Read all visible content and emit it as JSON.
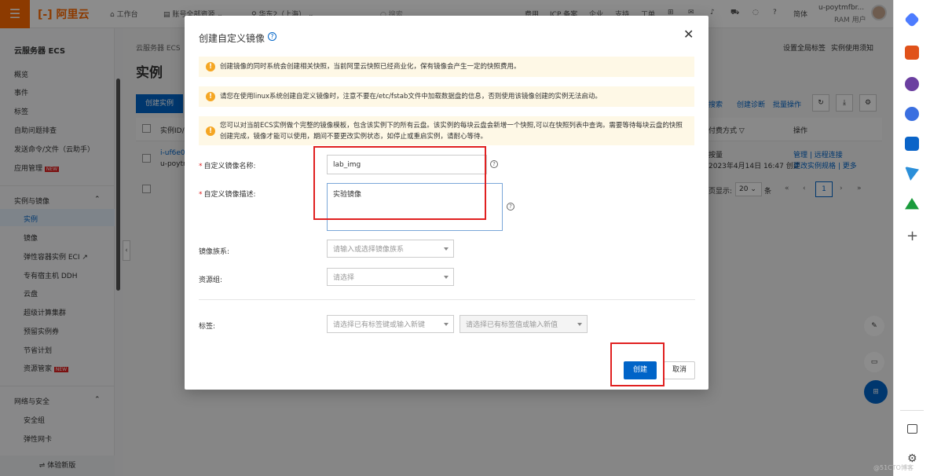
{
  "topbar": {
    "logo": "阿里云",
    "workbench": "工作台",
    "resources": "账号全部资源",
    "region": "华东2（上海）",
    "search_placeholder": "搜索...",
    "links": [
      "费用",
      "ICP 备案",
      "企业",
      "支持",
      "工单"
    ],
    "lang": "简体",
    "user_name": "u-poytmfbr...",
    "user_type": "RAM 用户"
  },
  "sidebar": {
    "title": "云服务器 ECS",
    "items": [
      "概览",
      "事件",
      "标签",
      "自助问题排查",
      "发送命令/文件（云助手）",
      "应用管理"
    ],
    "group1": "实例与镜像",
    "group1_items": [
      "实例",
      "镜像",
      "弹性容器实例 ECI",
      "专有宿主机 DDH",
      "云盘",
      "超级计算集群",
      "预留实例券",
      "节省计划",
      "资源管家"
    ],
    "group2": "网络与安全",
    "group2_items": [
      "安全组",
      "弹性网卡"
    ],
    "footer": "⇌ 体验新版",
    "new_badge": "NEW"
  },
  "main": {
    "breadcrumb": "云服务器 ECS",
    "page_title": "实例",
    "create_instance": "创建实例",
    "top_links": [
      "设置全局标签",
      "实例使用须知"
    ],
    "toolbar_links": [
      "搜索",
      "创建诊断",
      "批量操作"
    ],
    "col_instance": "实例ID/",
    "col_billing": "付费方式",
    "col_actions": "操作",
    "row_id": "i-uf6e0",
    "row_name": "u-poytr",
    "row_billing": "按量",
    "row_created": "2023年4月14日 16:47 创建",
    "row_actions": "管理 | 远程连接",
    "row_actions2": "更改实例规格 | 更多",
    "pager_label": "页显示:",
    "pager_size": "20",
    "pager_unit": "条",
    "pager_current": "1"
  },
  "modal": {
    "title": "创建自定义镜像",
    "notice1": "创建镜像的同时系统会创建相关快照，当前阿里云快照已经商业化，保有镜像会产生一定的快照费用。",
    "notice2": "请您在使用linux系统创建自定义镜像时，注意不要在/etc/fstab文件中加载数据盘的信息，否则使用该镜像创建的实例无法启动。",
    "notice3": "您可以对当前ECS实例做个完整的镜像模板，包含该实例下的所有云盘。该实例的每块云盘会新增一个快照,可以在快照列表中查询。需要等待每块云盘的快照创建完成，镜像才能可以使用，期间不要更改实例状态，如停止或重启实例，请耐心等待。",
    "name_label": "自定义镜像名称:",
    "name_value": "lab_img",
    "desc_label": "自定义镜像描述:",
    "desc_value": "实验镜像",
    "family_label": "镜像族系:",
    "family_placeholder": "请输入或选择镜像族系",
    "group_label": "资源组:",
    "group_placeholder": "请选择",
    "tag_label": "标签:",
    "tag_key_placeholder": "请选择已有标签键或输入新键",
    "tag_value_placeholder": "请选择已有标签值或输入新值",
    "create": "创建",
    "cancel": "取消"
  },
  "watermark": "@51CTO博客",
  "colors": {
    "accent": "#0064c8",
    "brand": "#ff6a00",
    "highlight": "#e02020",
    "notice_bg": "#fef8e6"
  }
}
